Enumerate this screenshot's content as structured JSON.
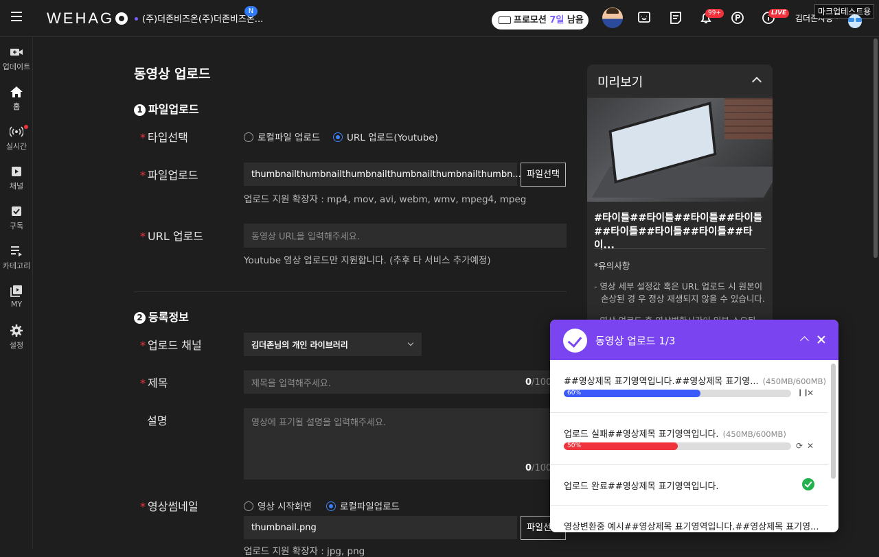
{
  "header": {
    "logo": "WEHAG",
    "company": "(주)더존비즈온(주)더존비즈온...",
    "new_badge": "N",
    "promo_prefix": "프로모션 ",
    "promo_days": "7일",
    "promo_suffix": " 남음",
    "notif_count": "99+",
    "live_label": "LIVE",
    "username": "김더존사용 ·",
    "mark_test": "마크업테스트용"
  },
  "sidebar": {
    "items": [
      {
        "label": "업데이트",
        "icon": "video-plus-icon"
      },
      {
        "label": "홈",
        "icon": "home-icon"
      },
      {
        "label": "실시간",
        "icon": "live-broadcast-icon"
      },
      {
        "label": "채널",
        "icon": "channel-icon"
      },
      {
        "label": "구독",
        "icon": "subscribe-icon"
      },
      {
        "label": "카테고리",
        "icon": "category-icon"
      },
      {
        "label": "MY",
        "icon": "my-playlist-icon"
      },
      {
        "label": "설정",
        "icon": "gear-icon"
      }
    ]
  },
  "page": {
    "title": "동영상 업로드",
    "section1": {
      "num": "1",
      "title": "파일업로드"
    },
    "type_label": "타입선택",
    "type_options": [
      "로컬파일 업로드",
      "URL 업로드(Youtube)"
    ],
    "file_label": "파일업로드",
    "file_value": "thumbnailthumbnailthumbnailthumbnailthumbnailthumbn....png",
    "file_button": "파일선택",
    "file_help": "업로드 지원 확장자 : mp4, mov, avi, webm, wmv, mpeg4, mpeg",
    "url_label": "URL 업로드",
    "url_placeholder": "동영상 URL을 입력해주세요.",
    "url_help": "Youtube 영상 업로드만 지원합니다. (추후 타 서비스 추가예정)",
    "section2": {
      "num": "2",
      "title": "등록정보"
    },
    "channel_label": "업로드 채널",
    "channel_value": "김더존님의 개인 라이브러리",
    "title_label": "제목",
    "title_placeholder": "제목을 입력해주세요.",
    "title_count": "0",
    "title_max": "/100",
    "desc_label": "설명",
    "desc_placeholder": "영상에 표기될 설명을 입력해주세요.",
    "desc_count": "0",
    "desc_max": "/100",
    "thumb_label": "영상썸네일",
    "thumb_options": [
      "영상 시작화면",
      "로컬파일업로드"
    ],
    "thumb_value": "thumbnail.png",
    "thumb_button": "파일선택",
    "thumb_help": "업로드 지원 확장자 : jpg, png"
  },
  "preview": {
    "title": "미리보기",
    "video_title": "#타이틀##타이틀##타이틀##타이틀##타이틀##타이틀##타이틀##타이...",
    "notice_heading": "*유의사항",
    "notice_1": "- 영상 세부 설정값 혹은 URL 업로드 시 원본이 손상된 경 우 정상 재생되지 않을 수 있습니다.",
    "notice_2": "- 영상 업로드 후 영상변환시간이 일부 소요됩"
  },
  "upload_panel": {
    "title": "동영상 업로드 1/3",
    "items": [
      {
        "name": "##영상제목 표기영역입니다.##영상제목 표기영...",
        "size": "(450MB/600MB)",
        "progress": 60,
        "progress_label": "60%",
        "status": "uploading"
      },
      {
        "name": "업로드 실패##영상제목 표기영역입니다.",
        "size": "(450MB/600MB)",
        "progress": 50,
        "progress_label": "50%",
        "status": "failed"
      },
      {
        "name": "업로드 완료##영상제목 표기영역입니다.",
        "size": "",
        "status": "done"
      },
      {
        "name": "영상변환중 예시##영상제목 표기영역입니다.##영상제목 표기영...",
        "size": "",
        "status": "converting"
      }
    ]
  },
  "colors": {
    "accent": "#7a45f0",
    "progress_blue": "#3b5bfa",
    "progress_red": "#f0323c",
    "required": "#f0323c"
  }
}
